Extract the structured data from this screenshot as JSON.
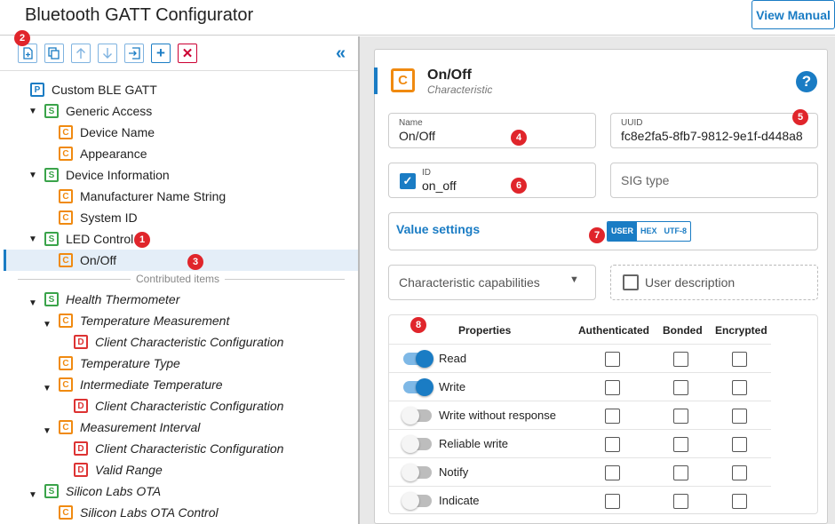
{
  "app": {
    "title": "Bluetooth GATT Configurator",
    "manual_button": "View Manual"
  },
  "toolbar": {
    "buttons": [
      "add-item-icon",
      "copy-icon",
      "move-up-icon",
      "move-down-icon",
      "import-icon",
      "add-icon",
      "delete-icon"
    ],
    "collapse_icon": "double-chevron-left-icon"
  },
  "tree": {
    "root": "Custom BLE GATT",
    "generic_access": "Generic Access",
    "device_name": "Device Name",
    "appearance": "Appearance",
    "device_information": "Device Information",
    "manufacturer": "Manufacturer Name String",
    "system_id": "System ID",
    "led_control": "LED Control",
    "on_off": "On/Off",
    "contributed": "Contributed items",
    "health_thermometer": "Health Thermometer",
    "temp_measurement": "Temperature Measurement",
    "cccd1": "Client Characteristic Configuration",
    "temp_type": "Temperature Type",
    "intermediate_temp": "Intermediate Temperature",
    "cccd2": "Client Characteristic Configuration",
    "measurement_interval": "Measurement Interval",
    "cccd3": "Client Characteristic Configuration",
    "valid_range": "Valid Range",
    "silabs_ota": "Silicon Labs OTA",
    "silabs_ota_control": "Silicon Labs OTA Control",
    "badges": {
      "P": "P",
      "S": "S",
      "C": "C",
      "D": "D"
    }
  },
  "markers": [
    "1",
    "2",
    "3",
    "4",
    "5",
    "6",
    "7",
    "8"
  ],
  "detail": {
    "badge": "C",
    "title": "On/Off",
    "subtitle": "Characteristic",
    "help": "?",
    "name_label": "Name",
    "name_value": "On/Off",
    "uuid_label": "UUID",
    "uuid_value": "fc8e2fa5-8fb7-9812-9e1f-d448a8",
    "id_label": "ID",
    "id_value": "on_off",
    "id_checked": true,
    "sig_placeholder": "SIG type",
    "value_settings": "Value settings",
    "value_modes": [
      "USER",
      "HEX",
      "UTF-8"
    ],
    "value_mode_selected": "USER",
    "capabilities_placeholder": "Characteristic capabilities",
    "user_description": "User description",
    "user_description_checked": false
  },
  "properties": {
    "headers": [
      "Properties",
      "Authenticated",
      "Bonded",
      "Encrypted"
    ],
    "rows": [
      {
        "label": "Read",
        "on": true,
        "authenticated": false,
        "bonded": false,
        "encrypted": false
      },
      {
        "label": "Write",
        "on": true,
        "authenticated": false,
        "bonded": false,
        "encrypted": false
      },
      {
        "label": "Write without response",
        "on": false,
        "authenticated": false,
        "bonded": false,
        "encrypted": false
      },
      {
        "label": "Reliable write",
        "on": false,
        "authenticated": false,
        "bonded": false,
        "encrypted": false
      },
      {
        "label": "Notify",
        "on": false,
        "authenticated": false,
        "bonded": false,
        "encrypted": false
      },
      {
        "label": "Indicate",
        "on": false,
        "authenticated": false,
        "bonded": false,
        "encrypted": false
      }
    ]
  },
  "colors": {
    "accent": "#1a7cc4",
    "marker": "#e0252b",
    "service": "#3aa34a",
    "characteristic": "#f08a10",
    "descriptor": "#d33"
  }
}
